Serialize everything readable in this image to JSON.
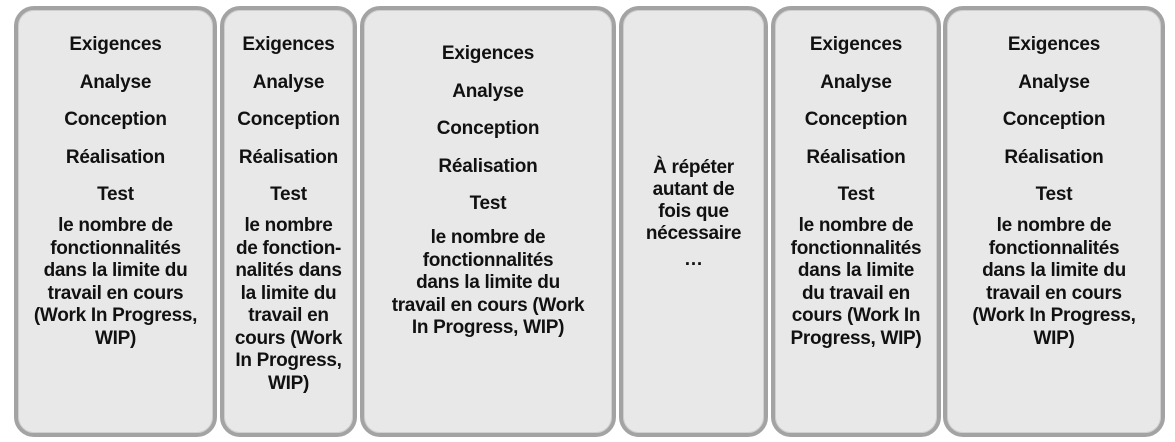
{
  "panels": [
    {
      "steps": [
        "Exigences",
        "Analyse",
        "Conception",
        "Réalisation",
        "Test"
      ],
      "wip": "le nombre de\nfonctionnalités\ndans la limite du\ntravail en cours\n(Work In Progress,\nWIP)"
    },
    {
      "steps": [
        "Exigences",
        "Analyse",
        "Conception",
        "Réalisation",
        "Test"
      ],
      "wip": "le nombre\nde fonction-\nnalités dans\nla limite du\ntravail en\ncours (Work\nIn Progress,\nWIP)"
    },
    {
      "steps": [
        "Exigences",
        "Analyse",
        "Conception",
        "Réalisation",
        "Test"
      ],
      "wip": "le nombre de\nfonctionnalités\ndans la limite du\ntravail en cours (Work\nIn Progress, WIP)"
    },
    {
      "repeat": "À répéter\nautant de\nfois que\nnécessaire",
      "ellipsis": "…"
    },
    {
      "steps": [
        "Exigences",
        "Analyse",
        "Conception",
        "Réalisation",
        "Test"
      ],
      "wip": "le nombre de\nfonctionnalités\ndans la limite\ndu travail en\ncours (Work In\nProgress, WIP)"
    },
    {
      "steps": [
        "Exigences",
        "Analyse",
        "Conception",
        "Réalisation",
        "Test"
      ],
      "wip": "le nombre de\nfonctionnalités\ndans la limite du\ntravail en cours\n(Work In Progress,\nWIP)"
    }
  ]
}
